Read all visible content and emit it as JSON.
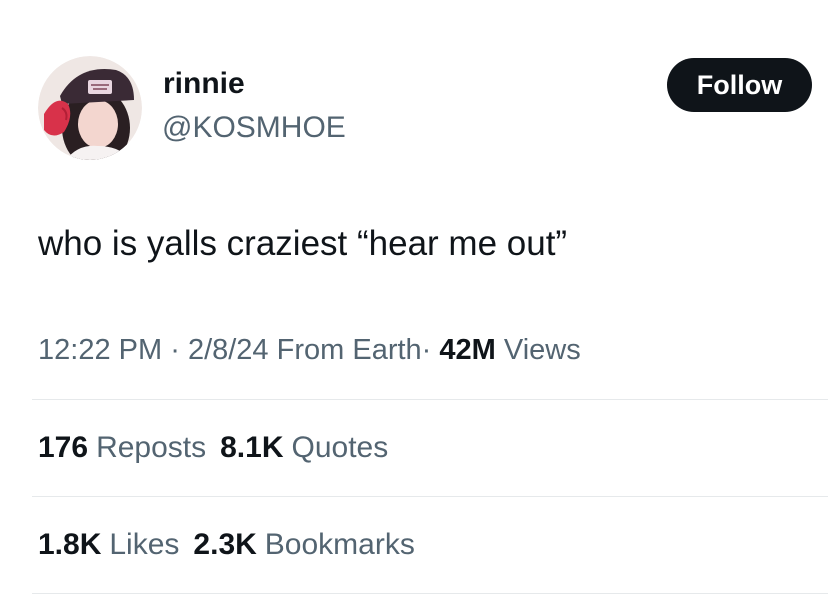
{
  "user": {
    "display_name": "rinnie",
    "handle": "@KOSMHOE",
    "avatar_icon": "profile-photo"
  },
  "follow_button": {
    "label": "Follow"
  },
  "tweet": {
    "text": "who is yalls craziest “hear me out”"
  },
  "meta": {
    "time": "12:22 PM",
    "separator": "·",
    "date": "2/8/24",
    "source": "From Earth",
    "views_count": "42M",
    "views_label": "Views"
  },
  "stats": {
    "reposts": {
      "count": "176",
      "label": "Reposts"
    },
    "quotes": {
      "count": "8.1K",
      "label": "Quotes"
    },
    "likes": {
      "count": "1.8K",
      "label": "Likes"
    },
    "bookmarks": {
      "count": "2.3K",
      "label": "Bookmarks"
    }
  },
  "colors": {
    "text_primary": "#0f1419",
    "text_secondary": "#536471",
    "divider": "#e6e9eb",
    "button_bg": "#0f1419",
    "button_text": "#ffffff"
  }
}
